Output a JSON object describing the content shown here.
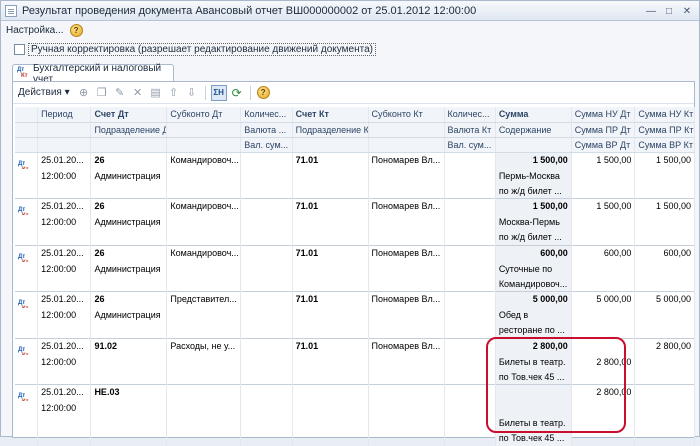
{
  "window": {
    "title": "Результат проведения документа Авансовый отчет ВШ000000002 от 25.01.2012 12:00:00"
  },
  "menu": {
    "settings": "Настройка..."
  },
  "options": {
    "manual_correction": "Ручная корректировка (разрешает редактирование движений документа)"
  },
  "tabs": [
    {
      "label": "Бухгалтерский и налоговый учет"
    }
  ],
  "toolbar": {
    "actions_label": "Действия ▾"
  },
  "table": {
    "header1": [
      "",
      "Период",
      "Счет Дт",
      "Субконто Дт",
      "Количес...",
      "Счет Кт",
      "Субконто Кт",
      "Количес...",
      "Сумма",
      "Сумма НУ Дт",
      "Сумма НУ Кт"
    ],
    "header2": [
      "",
      "",
      "Подразделение Дт",
      "",
      "Валюта ...",
      "Подразделение Кт",
      "",
      "Валюта Кт",
      "Содержание",
      "Сумма ПР Дт",
      "Сумма ПР Кт"
    ],
    "header3": [
      "",
      "",
      "",
      "",
      "Вал. сум...",
      "",
      "",
      "Вал. сум...",
      "",
      "Сумма ВР Дт",
      "Сумма ВР Кт"
    ],
    "rows": [
      {
        "line1": [
          "",
          "25.01.20...",
          "26",
          "Командировоч...",
          "",
          "71.01",
          "Пономарев Вл...",
          "",
          "1 500,00",
          "1 500,00",
          "1 500,00"
        ],
        "line2": [
          "",
          "12:00:00",
          "Администрация",
          "",
          "",
          "",
          "",
          "",
          "Пермь-Москва",
          "",
          ""
        ],
        "line3": [
          "",
          "",
          "",
          "",
          "",
          "",
          "",
          "",
          "по ж/д билет ...",
          "",
          ""
        ]
      },
      {
        "line1": [
          "",
          "25.01.20...",
          "26",
          "Командировоч...",
          "",
          "71.01",
          "Пономарев Вл...",
          "",
          "1 500,00",
          "1 500,00",
          "1 500,00"
        ],
        "line2": [
          "",
          "12:00:00",
          "Администрация",
          "",
          "",
          "",
          "",
          "",
          "Москва-Пермь",
          "",
          ""
        ],
        "line3": [
          "",
          "",
          "",
          "",
          "",
          "",
          "",
          "",
          "по ж/д билет ...",
          "",
          ""
        ]
      },
      {
        "line1": [
          "",
          "25.01.20...",
          "26",
          "Командировоч...",
          "",
          "71.01",
          "Пономарев Вл...",
          "",
          "600,00",
          "600,00",
          "600,00"
        ],
        "line2": [
          "",
          "12:00:00",
          "Администрация",
          "",
          "",
          "",
          "",
          "",
          "Суточные по",
          "",
          ""
        ],
        "line3": [
          "",
          "",
          "",
          "",
          "",
          "",
          "",
          "",
          "Командировоч...",
          "",
          ""
        ]
      },
      {
        "line1": [
          "",
          "25.01.20...",
          "26",
          "Представител...",
          "",
          "71.01",
          "Пономарев Вл...",
          "",
          "5 000,00",
          "5 000,00",
          "5 000,00"
        ],
        "line2": [
          "",
          "12:00:00",
          "Администрация",
          "",
          "",
          "",
          "",
          "",
          "Обед в",
          "",
          ""
        ],
        "line3": [
          "",
          "",
          "",
          "",
          "",
          "",
          "",
          "",
          "ресторане по ...",
          "",
          ""
        ]
      },
      {
        "line1": [
          "",
          "25.01.20...",
          "91.02",
          "Расходы, не у...",
          "",
          "71.01",
          "Пономарев Вл...",
          "",
          "2 800,00",
          "",
          "2 800,00"
        ],
        "line2": [
          "",
          "12:00:00",
          "",
          "",
          "",
          "",
          "",
          "",
          "Билеты в театр.",
          "2 800,00",
          ""
        ],
        "line3": [
          "",
          "",
          "",
          "",
          "",
          "",
          "",
          "",
          "по Тов.чек 45 ...",
          "",
          ""
        ]
      },
      {
        "line1": [
          "",
          "25.01.20...",
          "НЕ.03",
          "",
          "",
          "",
          "",
          "",
          "",
          "2 800,00",
          ""
        ],
        "line2": [
          "",
          "12:00:00",
          "",
          "",
          "",
          "",
          "",
          "",
          "",
          "",
          ""
        ],
        "line3": [
          "",
          "",
          "",
          "",
          "",
          "",
          "",
          "",
          "Билеты в театр.",
          "",
          ""
        ],
        "line4": [
          "",
          "",
          "",
          "",
          "",
          "",
          "",
          "",
          "по Тов.чек 45 ...",
          "",
          ""
        ]
      }
    ]
  },
  "colors": {
    "highlight": "#c8102e",
    "accent": "#1a5fb4"
  }
}
